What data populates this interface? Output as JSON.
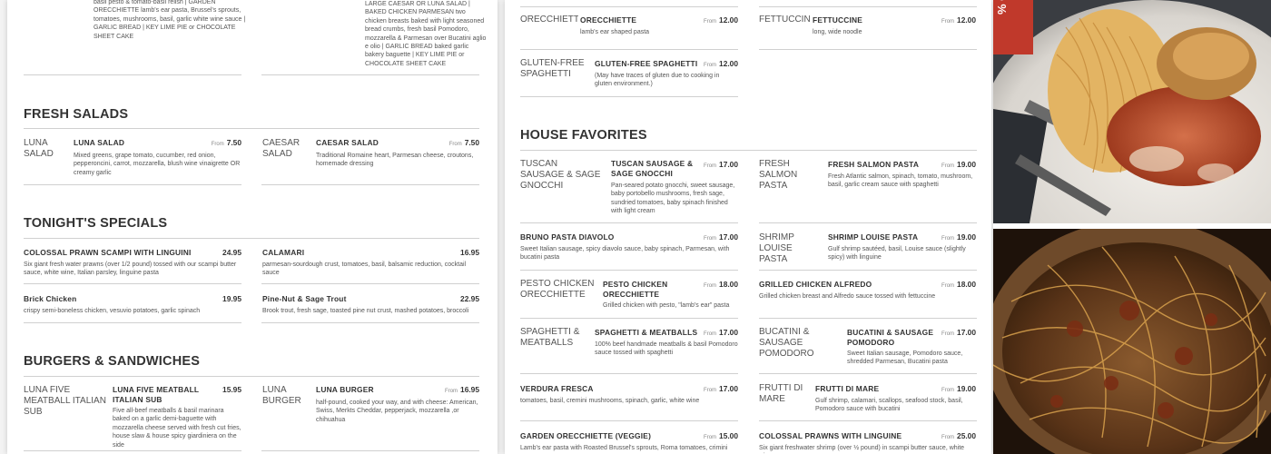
{
  "left": {
    "top_fragments": {
      "desc1": "basil pesto & tomato-basil relish | GARDEN ORECCHIETTE lamb's ear pasta, Brussel's sprouts, tomatoes, mushrooms, basil, garlic white wine sauce | GARLIC BREAD | KEY LIME PIE or CHOCOLATE SHEET CAKE",
      "desc2": "LARGE CAESAR OR LUNA SALAD | BAKED CHICKEN PARMESAN two chicken breasts baked with light seasoned bread crumbs, fresh basil Pomodoro, mozzarella & Parmesan over Bucatini aglio e olio | GARLIC BREAD baked garlic bakery baguette | KEY LIME PIE or CHOCOLATE SHEET CAKE"
    },
    "fresh_salads": {
      "title": "FRESH SALADS",
      "items": [
        {
          "thumb": "LUNA SALAD",
          "name": "LUNA SALAD",
          "from": "From",
          "price": "7.50",
          "desc": "Mixed greens, grape tomato, cucumber, red onion, pepperoncini, carrot, mozzarella, blush wine vinaigrette OR creamy garlic"
        },
        {
          "thumb": "CAESAR SALAD",
          "name": "CAESAR SALAD",
          "from": "From",
          "price": "7.50",
          "desc": "Traditional Romaine heart, Parmesan cheese, croutons, homemade dressing"
        }
      ]
    },
    "tonights_specials": {
      "title": "TONIGHT'S SPECIALS",
      "items": [
        {
          "name": "COLOSSAL PRAWN SCAMPI WITH LINGUINI",
          "price": "24.95",
          "desc": "Six giant fresh water prawns (over 1/2 pound) tossed with our scampi butter sauce, white wine, Italian parsley, linguine pasta"
        },
        {
          "name": "CALAMARI",
          "price": "16.95",
          "desc": "parmesan-sourdough crust, tomatoes, basil, balsamic reduction, cocktail sauce"
        },
        {
          "name": "Brick Chicken",
          "price": "19.95",
          "desc": "crispy semi-boneless chicken, vesuvio potatoes, garlic spinach"
        },
        {
          "name": "Pine-Nut & Sage Trout",
          "price": "22.95",
          "desc": "Brook trout, fresh sage, toasted pine nut crust, mashed potatoes, broccoli"
        }
      ]
    },
    "burgers": {
      "title": "BURGERS & SANDWICHES",
      "items": [
        {
          "thumb": "LUNA FIVE MEATBALL ITALIAN SUB",
          "name": "LUNA FIVE MEATBALL ITALIAN SUB",
          "price": "15.95",
          "desc": "Five all-beef meatballs & basil marinara baked on a garlic demi-baguette with mozzarella cheese served with fresh cut fries, house slaw & house spicy giardiniera on the side"
        },
        {
          "thumb": "LUNA BURGER",
          "name": "LUNA BURGER",
          "from": "From",
          "price": "16.95",
          "desc": "half-pound, cooked your way, and with cheese: American, Swiss, Merkts Cheddar, pepperjack, mozzarella ,or chihuahua"
        }
      ]
    }
  },
  "mid": {
    "top_items": [
      {
        "thumb": "ORECCHIETTE",
        "name": "ORECCHIETTE",
        "from": "From",
        "price": "12.00",
        "desc": "lamb's ear shaped pasta"
      },
      {
        "thumb": "FETTUCCINE",
        "name": "FETTUCCINE",
        "from": "From",
        "price": "12.00",
        "desc": "long, wide noodle"
      },
      {
        "thumb": "GLUTEN-FREE SPAGHETTI",
        "name": "GLUTEN-FREE SPAGHETTI",
        "from": "From",
        "price": "12.00",
        "desc": "(May have traces of gluten due to cooking in gluten environment.)"
      }
    ],
    "house_favorites": {
      "title": "HOUSE FAVORITES",
      "items": [
        {
          "thumb": "TUSCAN SAUSAGE & SAGE GNOCCHI",
          "name": "TUSCAN SAUSAGE & SAGE GNOCCHI",
          "from": "From",
          "price": "17.00",
          "desc": "Pan-seared potato gnocchi, sweet sausage, baby portobello mushrooms, fresh sage, sundried tomatoes, baby spinach finished with light cream"
        },
        {
          "thumb": "FRESH SALMON PASTA",
          "name": "FRESH SALMON PASTA",
          "from": "From",
          "price": "19.00",
          "desc": "Fresh Atlantic salmon, spinach, tomato, mushroom, basil, garlic cream sauce with spaghetti"
        },
        {
          "name": "BRUNO PASTA DIAVOLO",
          "from": "From",
          "price": "17.00",
          "desc": "Sweet Italian sausage, spicy diavolo sauce, baby spinach, Parmesan, with bucatini pasta"
        },
        {
          "thumb": "SHRIMP LOUISE PASTA",
          "name": "SHRIMP LOUISE PASTA",
          "from": "From",
          "price": "19.00",
          "desc": "Gulf shrimp sautéed, basil, Louise sauce (slightly spicy) with linguine"
        },
        {
          "thumb": "PESTO CHICKEN ORECCHIETTE",
          "name": "PESTO CHICKEN ORECCHIETTE",
          "from": "From",
          "price": "18.00",
          "desc": "Grilled chicken with pesto, \"lamb's ear\" pasta"
        },
        {
          "name": "GRILLED CHICKEN ALFREDO",
          "from": "From",
          "price": "18.00",
          "desc": "Grilled chicken breast and Alfredo sauce tossed with fettuccine"
        },
        {
          "thumb": "SPAGHETTI & MEATBALLS",
          "name": "SPAGHETTI & MEATBALLS",
          "from": "From",
          "price": "17.00",
          "desc": "100% beef handmade meatballs & basil Pomodoro sauce tossed with spaghetti"
        },
        {
          "thumb": "BUCATINI & SAUSAGE POMODORO",
          "name": "BUCATINI & SAUSAGE POMODORO",
          "from": "From",
          "price": "17.00",
          "desc": "Sweet Italian sausage, Pomodoro sauce, shredded Parmesan, Bucatini pasta"
        },
        {
          "name": "VERDURA FRESCA",
          "from": "From",
          "price": "17.00",
          "desc": "tomatoes, basil, cremini mushrooms, spinach, garlic, white wine"
        },
        {
          "thumb": "FRUTTI DI MARE",
          "name": "FRUTTI DI MARE",
          "from": "From",
          "price": "19.00",
          "desc": "Gulf shrimp, calamari, scallops, seafood stock, basil, Pomodoro sauce with bucatini"
        },
        {
          "name": "GARDEN ORECCHIETTE (VEGGIE)",
          "from": "From",
          "price": "15.00",
          "desc": "Lamb's ear pasta with Roasted Brussel's sprouts, Roma tomatoes, crimini"
        },
        {
          "name": "COLOSSAL PRAWNS WITH LINGUINE",
          "from": "From",
          "price": "25.00",
          "desc": "Six giant freshwater shrimp (over ½ pound) in scampi butter sauce, white wine,"
        }
      ]
    }
  },
  "right": {
    "banner_text": "% OFF"
  },
  "colors": {
    "panel_bg": "#ffffff",
    "page_bg": "#f3f3f3",
    "rule": "#d0d0d0",
    "text": "#333333",
    "banner_red": "#c0392b"
  }
}
